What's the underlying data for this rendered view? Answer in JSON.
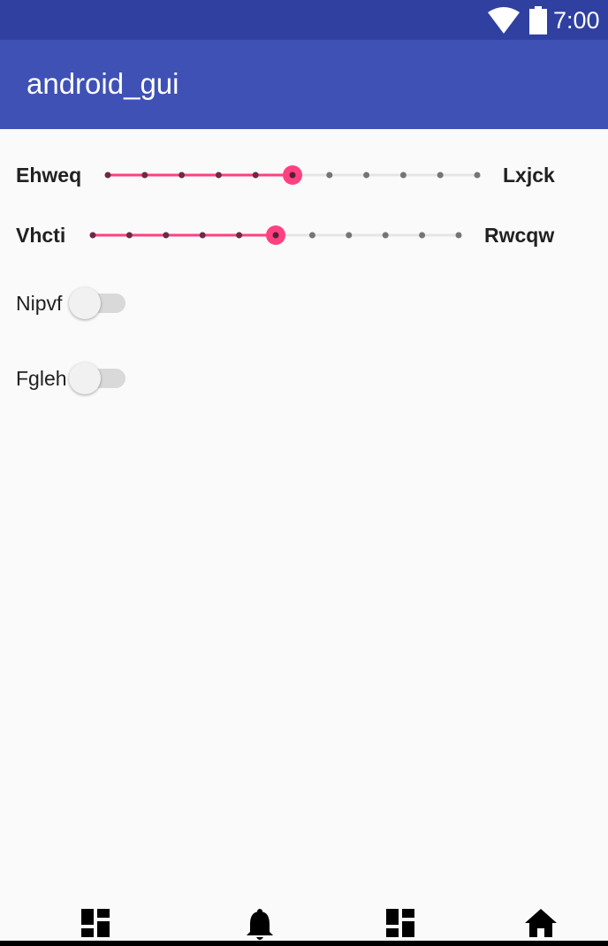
{
  "status_bar": {
    "time": "7:00",
    "wifi_icon": "wifi-icon",
    "battery_icon": "battery-icon"
  },
  "app_bar": {
    "title": "android_gui"
  },
  "seekbars": [
    {
      "start_label": "Ehweq",
      "end_label": "Lxjck",
      "steps": 10,
      "value": 5
    },
    {
      "start_label": "Vhcti",
      "end_label": "Rwcqw",
      "steps": 10,
      "value": 5
    }
  ],
  "switches": [
    {
      "label": "Nipvf",
      "checked": false
    },
    {
      "label": "Fgleh",
      "checked": false
    }
  ],
  "bottom_nav": {
    "items": [
      {
        "icon": "dashboard-icon"
      },
      {
        "icon": "notifications-icon"
      },
      {
        "icon": "dashboard-icon"
      },
      {
        "icon": "home-icon"
      }
    ]
  },
  "colors": {
    "status_bar": "#2f40a0",
    "app_bar": "#3f51b5",
    "accent": "#ff4081",
    "background": "#fafafa"
  }
}
